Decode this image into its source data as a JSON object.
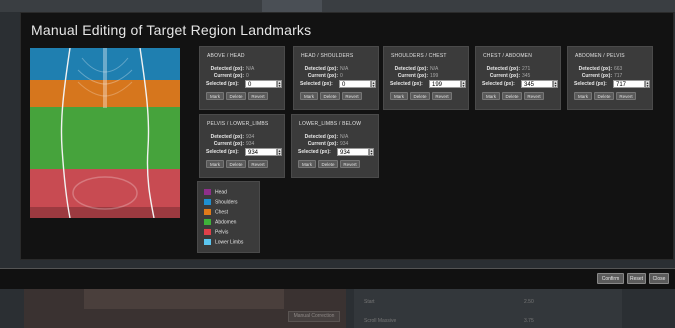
{
  "dialog": {
    "title": "Manual Editing of Target Region Landmarks"
  },
  "cards": [
    {
      "title": "ABOVE / HEAD",
      "detected_label": "Detected (px):",
      "detected": "N/A",
      "current_label": "Current (px):",
      "current": "0",
      "selected_label": "Selected (px):",
      "selected": "0"
    },
    {
      "title": "HEAD / SHOULDERS",
      "detected_label": "Detected (px):",
      "detected": "N/A",
      "current_label": "Current (px):",
      "current": "0",
      "selected_label": "Selected (px):",
      "selected": "0"
    },
    {
      "title": "SHOULDERS / CHEST",
      "detected_label": "Detected (px):",
      "detected": "N/A",
      "current_label": "Current (px):",
      "current": "199",
      "selected_label": "Selected (px):",
      "selected": "199"
    },
    {
      "title": "CHEST / ABDOMEN",
      "detected_label": "Detected (px):",
      "detected": "271",
      "current_label": "Current (px):",
      "current": "345",
      "selected_label": "Selected (px):",
      "selected": "345"
    },
    {
      "title": "ABDOMEN / PELVIS",
      "detected_label": "Detected (px):",
      "detected": "663",
      "current_label": "Current (px):",
      "current": "717",
      "selected_label": "Selected (px):",
      "selected": "717"
    },
    {
      "title": "PELVIS / LOWER_LIMBS",
      "detected_label": "Detected (px):",
      "detected": "934",
      "current_label": "Current (px):",
      "current": "934",
      "selected_label": "Selected (px):",
      "selected": "934"
    },
    {
      "title": "LOWER_LIMBS / BELOW",
      "detected_label": "Detected (px):",
      "detected": "N/A",
      "current_label": "Current (px):",
      "current": "934",
      "selected_label": "Selected (px):",
      "selected": "934"
    }
  ],
  "card_buttons": {
    "mark": "Mark",
    "delete": "Delete",
    "revert": "Revert"
  },
  "legend": [
    {
      "label": "Head",
      "color": "#8e2f8a"
    },
    {
      "label": "Shoulders",
      "color": "#1f8fd0"
    },
    {
      "label": "Chest",
      "color": "#e07a1a"
    },
    {
      "label": "Abdomen",
      "color": "#3fb23a"
    },
    {
      "label": "Pelvis",
      "color": "#e0404a"
    },
    {
      "label": "Lower Limbs",
      "color": "#5cc6f0"
    }
  ],
  "footer": {
    "confirm": "Confirm",
    "reset": "Reset",
    "close": "Close"
  },
  "background": {
    "button": "Manual Correction",
    "row1_label": "Start",
    "row1_value": "2.50",
    "row2_label": "Scroll Massive",
    "row2_value": "3.75"
  }
}
